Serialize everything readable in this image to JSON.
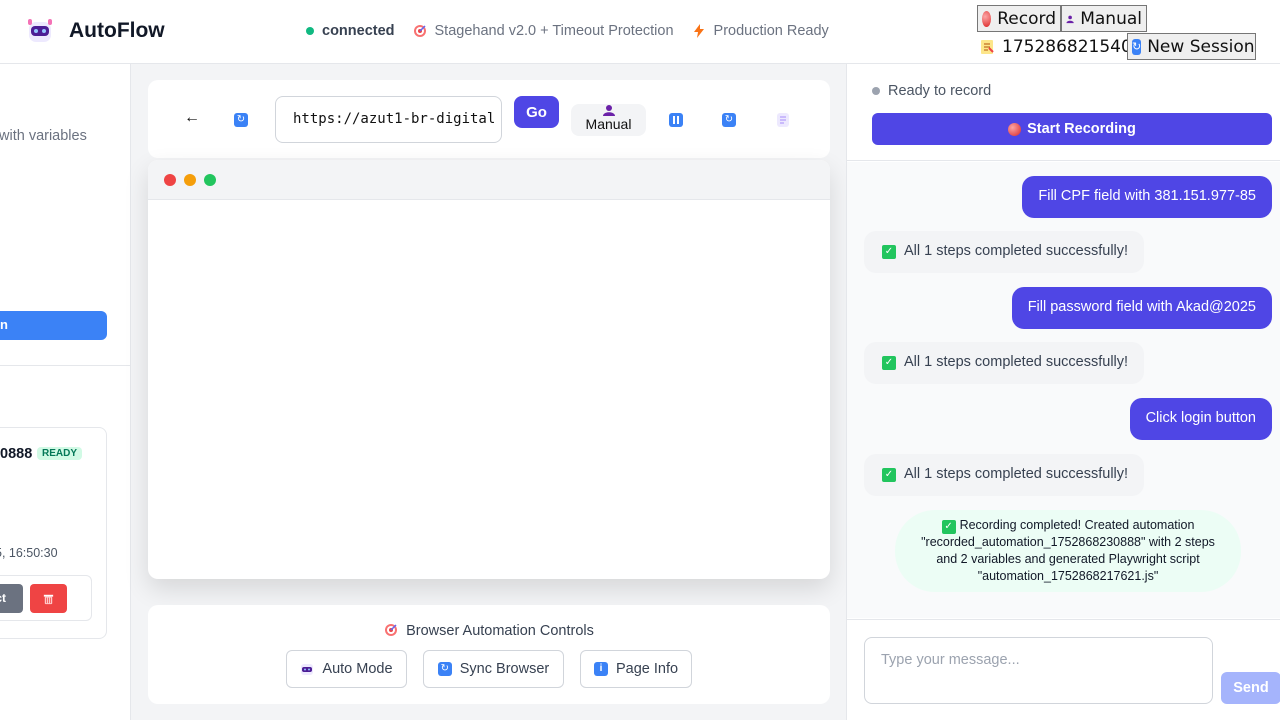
{
  "header": {
    "brand": "AutoFlow",
    "connection_status": "connected",
    "engine_label": "Stagehand v2.0 + Timeout Protection",
    "production_label": "Production Ready",
    "record_button": "Record",
    "manual_button": "Manual",
    "session_id": "175286821540...",
    "new_session_button": "New Session"
  },
  "sidebar": {
    "description_fragment": "with variables",
    "action_button_fragment": "n",
    "automation": {
      "id_fragment": "0888",
      "status_badge": "READY",
      "timestamp_fragment": "5, 16:50:30",
      "extract_button_fragment": "ract"
    }
  },
  "toolbar": {
    "back_glyph": "←",
    "url_value": "https://azut1-br-digital",
    "go_button": "Go",
    "manual_tab": "Manual"
  },
  "controls": {
    "title": "Browser Automation Controls",
    "auto_mode": "Auto Mode",
    "sync_browser": "Sync Browser",
    "page_info": "Page Info"
  },
  "recorder": {
    "status": "Ready to record",
    "start_button": "Start Recording"
  },
  "chat": {
    "messages": [
      {
        "role": "user",
        "text": "Fill CPF field with 381.151.977-85"
      },
      {
        "role": "bot",
        "text": "All 1 steps completed successfully!"
      },
      {
        "role": "user",
        "text": "Fill password field with Akad@2025"
      },
      {
        "role": "bot",
        "text": "All 1 steps completed successfully!"
      },
      {
        "role": "user",
        "text": "Click login button"
      },
      {
        "role": "bot",
        "text": "All 1 steps completed successfully!"
      }
    ],
    "final_message": "Recording completed! Created automation \"recorded_automation_1752868230888\" with 2 steps and 2 variables and generated Playwright script \"automation_1752868217621.js\"",
    "input_placeholder": "Type your message...",
    "send_button": "Send"
  },
  "colors": {
    "primary": "#4f46e5",
    "sidebar_button": "#3b82f6",
    "success": "#10b981",
    "danger": "#ef4444"
  }
}
